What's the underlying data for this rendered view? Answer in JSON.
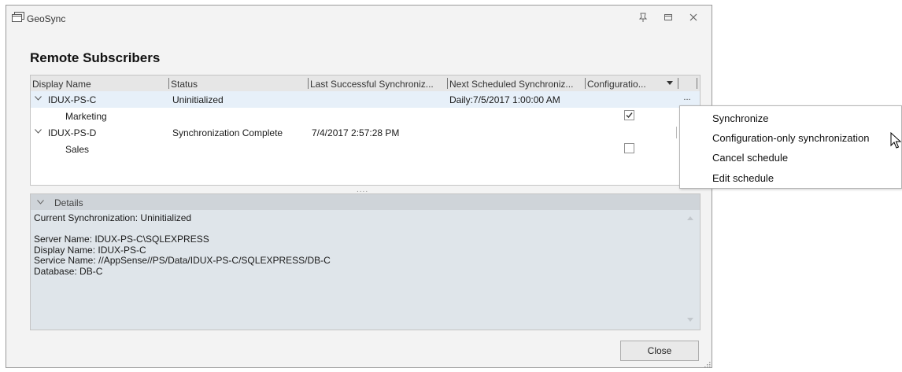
{
  "window": {
    "title": "GeoSync"
  },
  "page": {
    "heading": "Remote Subscribers"
  },
  "grid": {
    "columns": [
      "Display Name",
      "Status",
      "Last Successful Synchroniz...",
      "Next Scheduled Synchroniz...",
      "Configuratio..."
    ],
    "rows": [
      {
        "name": "IDUX-PS-C",
        "status": "Uninitialized",
        "last_sync": "",
        "next_sync": "Daily:7/5/2017 1:00:00 AM",
        "config": "",
        "ellipsis": "..."
      },
      {
        "name": "Marketing",
        "status": "",
        "last_sync": "",
        "next_sync": "",
        "config": "checked"
      },
      {
        "name": "IDUX-PS-D",
        "status": "Synchronization Complete",
        "last_sync": "7/4/2017 2:57:28 PM",
        "next_sync": "",
        "config": ""
      },
      {
        "name": "Sales",
        "status": "",
        "last_sync": "",
        "next_sync": "",
        "config": "unchecked"
      }
    ],
    "splitter": "...."
  },
  "details": {
    "title": "Details",
    "lines": [
      "Current Synchronization: Uninitialized",
      "",
      "Server Name: IDUX-PS-C\\SQLEXPRESS",
      "Display Name: IDUX-PS-C",
      "Service Name: //AppSense//PS/Data/IDUX-PS-C/SQLEXPRESS/DB-C",
      "Database: DB-C"
    ]
  },
  "buttons": {
    "close": "Close"
  },
  "context_menu": {
    "items": [
      "Synchronize",
      "Configuration-only synchronization",
      "Cancel schedule",
      "Edit schedule"
    ]
  },
  "colors": {
    "window_bg": "#f3f3f3",
    "selected_row": "#e7f0f9",
    "details_bg": "#dfe5ea"
  }
}
